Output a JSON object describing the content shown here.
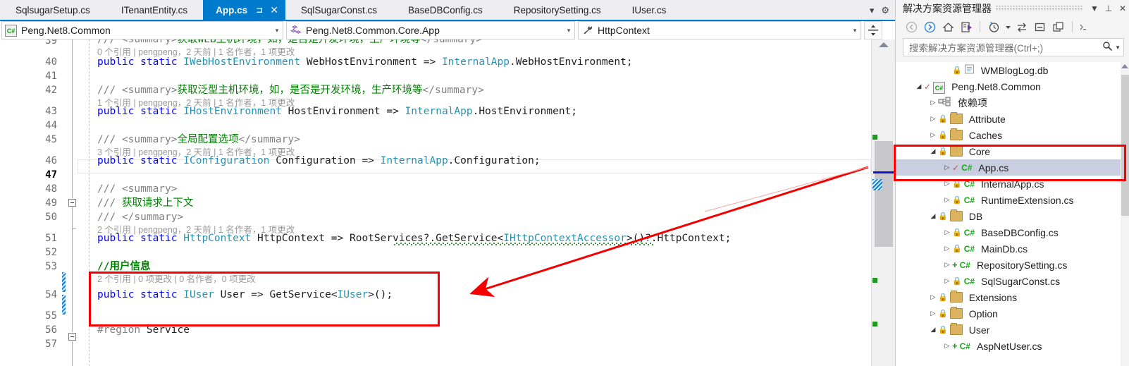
{
  "window": {
    "tabs": [
      {
        "label": "SqlsugarSetup.cs",
        "active": false
      },
      {
        "label": "ITenantEntity.cs",
        "active": false
      },
      {
        "label": "App.cs",
        "active": true
      },
      {
        "label": "SqlSugarConst.cs",
        "active": false
      },
      {
        "label": "BaseDBConfig.cs",
        "active": false
      },
      {
        "label": "RepositorySetting.cs",
        "active": false
      },
      {
        "label": "IUser.cs",
        "active": false
      }
    ],
    "tab_pin_icon": "pin-icon",
    "tab_close_icon": "close-icon",
    "tab_overflow_icon": "chevron-down-icon",
    "tab_settings_icon": "gear-icon"
  },
  "navbar": {
    "project": "Peng.Net8.Common",
    "type": "Peng.Net8.Common.Core.App",
    "member": "HttpContext",
    "project_icon": "csharp-project-icon",
    "type_icon": "class-icon",
    "member_icon": "property-icon",
    "dropdown_icon": "chevron-down-icon",
    "splitter_icon": "split-window-icon"
  },
  "editor": {
    "first_line": 39,
    "current_line": 47,
    "lines": [
      {
        "n": 39,
        "blank": false
      },
      {
        "n": 40,
        "blank": false
      },
      {
        "n": 41,
        "blank": true
      },
      {
        "n": 42,
        "blank": false
      },
      {
        "n": 43,
        "blank": false
      },
      {
        "n": 44,
        "blank": true
      },
      {
        "n": 45,
        "blank": false
      },
      {
        "n": 46,
        "blank": false
      },
      {
        "n": 47,
        "blank": true
      },
      {
        "n": 48,
        "blank": false
      },
      {
        "n": 49,
        "blank": false
      },
      {
        "n": 50,
        "blank": false
      },
      {
        "n": 51,
        "blank": false
      },
      {
        "n": 52,
        "blank": true
      },
      {
        "n": 53,
        "blank": false
      },
      {
        "n": 54,
        "blank": false
      },
      {
        "n": 55,
        "blank": true
      },
      {
        "n": 56,
        "blank": false
      },
      {
        "n": 57,
        "blank": true
      }
    ],
    "code": {
      "l39_doc_a": "/// <summary>",
      "l39_doc_cn": "获取WEB主机环境，如，是否是开发环境，生产环境等",
      "l39_doc_b": "</summary>",
      "lens39": "0 个引用 | pengpeng，2 天前 | 1 名作者，1 项更改",
      "l40": "public static IWebHostEnvironment WebHostEnvironment => InternalApp.WebHostEnvironment;",
      "l42_doc_a": "/// <summary>",
      "l42_doc_cn": "获取泛型主机环境，如，是否是开发环境，生产环境等",
      "l42_doc_b": "</summary>",
      "lens42": "1 个引用 | pengpeng，2 天前 | 1 名作者，1 项更改",
      "l43": "public static IHostEnvironment HostEnvironment => InternalApp.HostEnvironment;",
      "l45_doc_a": "/// <summary>",
      "l45_doc_cn": "全局配置选项",
      "l45_doc_b": "</summary>",
      "lens45": "3 个引用 | pengpeng，2 天前 | 1 名作者，1 项更改",
      "l46": "public static IConfiguration Configuration => InternalApp.Configuration;",
      "l48": "/// <summary>",
      "l49_a": "/// ",
      "l49_cn": "获取请求上下文",
      "l50": "/// </summary>",
      "lens50": "2 个引用 | pengpeng，2 天前 | 1 名作者，1 项更改",
      "l51": "public static HttpContext HttpContext => RootServices?.GetService<IHttpContextAccessor>()?.HttpContext;",
      "l53_cn": "//用户信息",
      "lens53": "2 个引用 | 0 项更改 | 0 名作者，0 项更改",
      "l54": "public static IUser User => GetService<IUser>();",
      "l56": "#region Service"
    }
  },
  "solution_explorer": {
    "title": "解决方案资源管理器",
    "dropdown_icon": "chevron-down-icon",
    "pin_icon": "pin-icon",
    "close_icon": "close-icon",
    "toolbar_icons": [
      "back-arrow-icon",
      "forward-arrow-icon",
      "home-icon",
      "sync-with-active-document-icon",
      "pending-changes-icon",
      "pending-changes-dropdown-icon",
      "refresh-icon",
      "collapse-all-icon",
      "show-all-files-icon",
      "properties-overflow-icon"
    ],
    "search_placeholder": "搜索解决方案资源管理器(Ctrl+;)",
    "search_icon": "search-icon",
    "search_dropdown_icon": "chevron-down-icon",
    "tree": [
      {
        "label": "WMBlogLog.db",
        "indent": 3,
        "exp": "none",
        "glyphs": [
          "lock",
          "db"
        ],
        "sel": false
      },
      {
        "label": "Peng.Net8.Common",
        "indent": 1,
        "exp": "open",
        "glyphs": [
          "check",
          "csproj"
        ],
        "sel": false
      },
      {
        "label": "依赖项",
        "indent": 2,
        "exp": "closed",
        "glyphs": [
          "deps"
        ],
        "sel": false
      },
      {
        "label": "Attribute",
        "indent": 2,
        "exp": "closed",
        "glyphs": [
          "lock",
          "folder"
        ],
        "sel": false
      },
      {
        "label": "Caches",
        "indent": 2,
        "exp": "closed",
        "glyphs": [
          "lock",
          "folder"
        ],
        "sel": false
      },
      {
        "label": "Core",
        "indent": 2,
        "exp": "open",
        "glyphs": [
          "lock",
          "folder"
        ],
        "sel": false
      },
      {
        "label": "App.cs",
        "indent": 3,
        "exp": "closed",
        "glyphs": [
          "check",
          "cs"
        ],
        "sel": true
      },
      {
        "label": "InternalApp.cs",
        "indent": 3,
        "exp": "closed",
        "glyphs": [
          "lock",
          "cs"
        ],
        "sel": false
      },
      {
        "label": "RuntimeExtension.cs",
        "indent": 3,
        "exp": "closed",
        "glyphs": [
          "lock",
          "cs"
        ],
        "sel": false
      },
      {
        "label": "DB",
        "indent": 2,
        "exp": "open",
        "glyphs": [
          "lock",
          "folder"
        ],
        "sel": false
      },
      {
        "label": "BaseDBConfig.cs",
        "indent": 3,
        "exp": "closed",
        "glyphs": [
          "lock",
          "cs"
        ],
        "sel": false
      },
      {
        "label": "MainDb.cs",
        "indent": 3,
        "exp": "closed",
        "glyphs": [
          "lock",
          "cs"
        ],
        "sel": false
      },
      {
        "label": "RepositorySetting.cs",
        "indent": 3,
        "exp": "closed",
        "glyphs": [
          "plus",
          "cs"
        ],
        "sel": false
      },
      {
        "label": "SqlSugarConst.cs",
        "indent": 3,
        "exp": "closed",
        "glyphs": [
          "lock",
          "cs"
        ],
        "sel": false
      },
      {
        "label": "Extensions",
        "indent": 2,
        "exp": "closed",
        "glyphs": [
          "lock",
          "folder"
        ],
        "sel": false
      },
      {
        "label": "Option",
        "indent": 2,
        "exp": "closed",
        "glyphs": [
          "lock",
          "folder"
        ],
        "sel": false
      },
      {
        "label": "User",
        "indent": 2,
        "exp": "open",
        "glyphs": [
          "lock",
          "folder"
        ],
        "sel": false
      },
      {
        "label": "AspNetUser.cs",
        "indent": 3,
        "exp": "closed",
        "glyphs": [
          "plus",
          "cs"
        ],
        "sel": false
      }
    ]
  },
  "annotations": {
    "accent_red": "#f40000",
    "box_code_label": "highlight-box-user-code",
    "box_tree_label": "highlight-box-app-cs",
    "arrow_label": "annotation-arrow"
  }
}
